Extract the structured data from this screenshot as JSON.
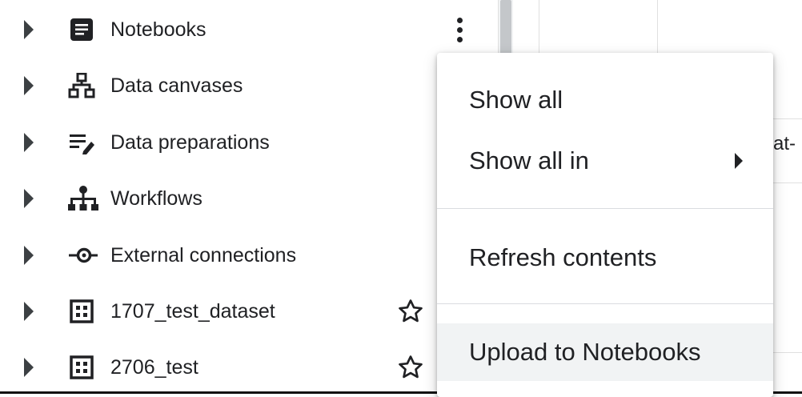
{
  "explorer": {
    "items": [
      {
        "label": "Notebooks",
        "icon": "notebook-icon",
        "starred": false,
        "has_menu": true
      },
      {
        "label": "Data canvases",
        "icon": "data-canvas-icon",
        "starred": false
      },
      {
        "label": "Data preparations",
        "icon": "data-preparation-icon",
        "starred": false
      },
      {
        "label": "Workflows",
        "icon": "workflow-icon",
        "starred": false
      },
      {
        "label": "External connections",
        "icon": "external-connection-icon",
        "starred": false
      },
      {
        "label": "1707_test_dataset",
        "icon": "dataset-icon",
        "starred": false,
        "star_icon": "star-outline-icon"
      },
      {
        "label": "2706_test",
        "icon": "dataset-icon",
        "starred": false,
        "star_icon": "star-outline-icon"
      }
    ]
  },
  "context_menu": {
    "items": [
      {
        "label": "Show all"
      },
      {
        "label": "Show all in",
        "has_submenu": true
      },
      {
        "label": "Refresh contents"
      },
      {
        "label": "Upload to Notebooks",
        "highlighted": true
      }
    ]
  },
  "background_pane": {
    "peek_text": "at-"
  },
  "colors": {
    "text": "#202124",
    "menu_highlight": "#f1f3f4",
    "divider": "#dadce0"
  }
}
